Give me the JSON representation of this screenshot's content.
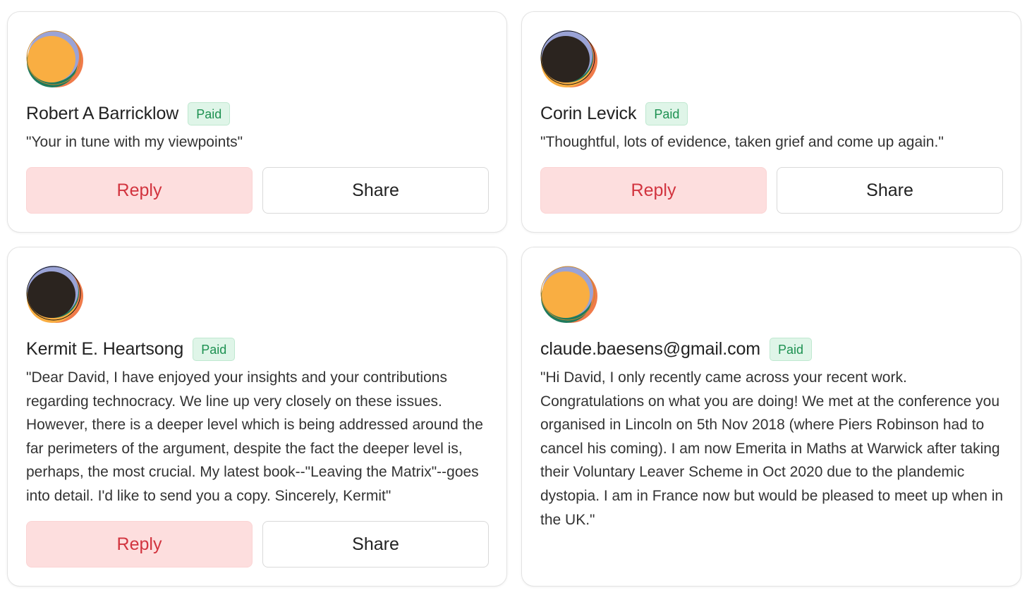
{
  "colors": {
    "badge_bg": "#dff5e8",
    "badge_text": "#1d9151",
    "reply_bg": "#fddede",
    "reply_text": "#d2343f",
    "card_border": "#e3e3e3"
  },
  "comments": [
    {
      "author": "Robert A Barricklow",
      "badge": "Paid",
      "avatar_icon": "avatar-orange-icon",
      "text": "\"Your in tune with my viewpoints\"",
      "reply_label": "Reply",
      "share_label": "Share"
    },
    {
      "author": "Corin Levick",
      "badge": "Paid",
      "avatar_icon": "avatar-dark-icon",
      "text": "\"Thoughtful, lots of evidence, taken grief and come up again.\"",
      "reply_label": "Reply",
      "share_label": "Share"
    },
    {
      "author": "Kermit E. Heartsong",
      "badge": "Paid",
      "avatar_icon": "avatar-dark-icon",
      "text": "\"Dear David, I have enjoyed your insights and your contributions regarding technocracy. We line up very closely on these issues. However, there is a deeper level which is being addressed around the far perimeters of the argument, despite the fact the deeper level is, perhaps, the most crucial. My latest book--\"Leaving the Matrix\"--goes into detail. I'd like to send you a copy. Sincerely, Kermit\"",
      "reply_label": "Reply",
      "share_label": "Share"
    },
    {
      "author": "claude.baesens@gmail.com",
      "badge": "Paid",
      "avatar_icon": "avatar-orange-icon",
      "text": "\"Hi David, I only recently came across your recent work. Congratulations on what you are doing! We met at the conference you organised in Lincoln on 5th Nov 2018 (where Piers Robinson had to cancel his coming). I am now Emerita in Maths at Warwick after taking their Voluntary Leaver Scheme in Oct 2020 due to the plandemic dystopia. I am in France now but would be pleased to meet up when in the UK.\""
    }
  ]
}
